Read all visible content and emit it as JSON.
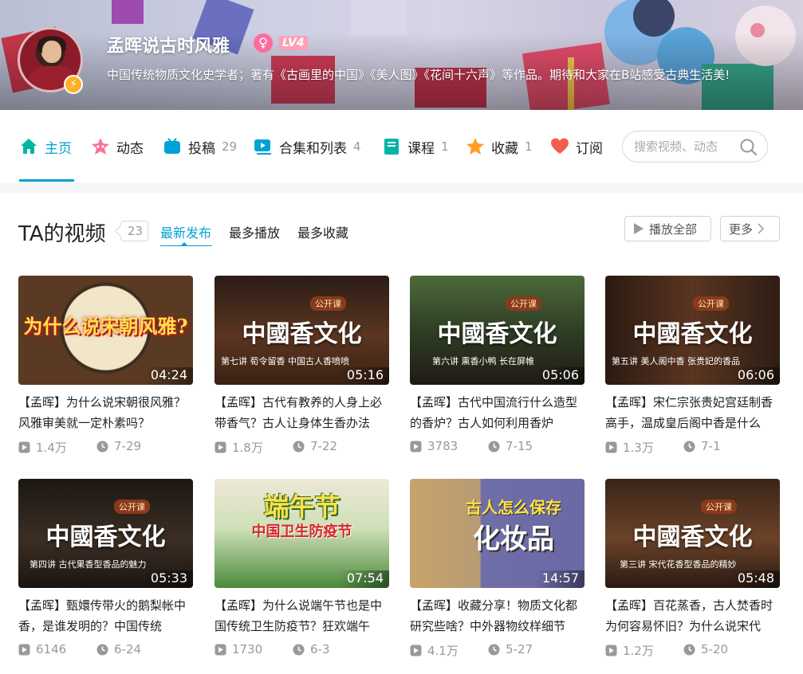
{
  "profile": {
    "name": "孟晖说古时风雅",
    "gender_icon": "♀",
    "level": "LV4",
    "badge_icon": "lightning-icon",
    "sign": "中国传统物质文化史学者；著有《古画里的中国》《美人图》《花间十六声》等作品。期待和大家在B站感受古典生活美!"
  },
  "nav": {
    "items": [
      {
        "label": "主页",
        "count": "",
        "icon": "home-icon",
        "color": "#00b5a5"
      },
      {
        "label": "动态",
        "count": "",
        "icon": "dynamic-icon",
        "color": "#fb7299"
      },
      {
        "label": "投稿",
        "count": "29",
        "icon": "video-icon",
        "color": "#00a1d6"
      },
      {
        "label": "合集和列表",
        "count": "4",
        "icon": "playlist-icon",
        "color": "#00a1d6"
      },
      {
        "label": "课程",
        "count": "1",
        "icon": "course-icon",
        "color": "#00b5a5"
      },
      {
        "label": "收藏",
        "count": "1",
        "icon": "star-icon",
        "color": "#ff9d26"
      },
      {
        "label": "订阅",
        "count": "",
        "icon": "heart-icon",
        "color": "#f25d4e"
      }
    ],
    "search_placeholder": "搜索视频、动态"
  },
  "videos_section": {
    "title": "TA的视频",
    "count": "23",
    "tabs": [
      "最新发布",
      "最多播放",
      "最多收藏"
    ],
    "play_all": "播放全部",
    "more": "更多"
  },
  "videos": [
    {
      "title": "【孟晖】为什么说宋朝很风雅？风雅审美就一定朴素吗？",
      "duration": "04:24",
      "plays": "1.4万",
      "date": "7-29",
      "cover_text": "为什么说宋朝风雅?",
      "cover_tag": "",
      "cover_sub": ""
    },
    {
      "title": "【孟晖】古代有教养的人身上必带香气？古人让身体生香办法",
      "duration": "05:16",
      "plays": "1.8万",
      "date": "7-22",
      "cover_text": "中國香文化",
      "cover_tag": "公开课",
      "cover_sub": "第七讲 荀令留香  中国古人香喷喷"
    },
    {
      "title": "【孟晖】古代中国流行什么造型的香炉？古人如何利用香炉",
      "duration": "05:06",
      "plays": "3783",
      "date": "7-15",
      "cover_text": "中國香文化",
      "cover_tag": "公开课",
      "cover_sub": "第六讲 熏香小鸭  长在屏帷"
    },
    {
      "title": "【孟晖】宋仁宗张贵妃宫廷制香高手，温成皇后阁中香是什么",
      "duration": "06:06",
      "plays": "1.3万",
      "date": "7-1",
      "cover_text": "中國香文化",
      "cover_tag": "公开课",
      "cover_sub": "第五讲 美人阁中香  张贵妃的香品"
    },
    {
      "title": "【孟晖】甄嬛传带火的鹅梨帐中香，是谁发明的？中国传统",
      "duration": "05:33",
      "plays": "6146",
      "date": "6-24",
      "cover_text": "中國香文化",
      "cover_tag": "公开课",
      "cover_sub": "第四讲  古代果香型香品的魅力"
    },
    {
      "title": "【孟晖】为什么说端午节也是中国传统卫生防疫节？狂欢端午",
      "duration": "07:54",
      "plays": "1730",
      "date": "6-3",
      "cover_text": "端午节",
      "cover_tag": "中国卫生防疫节",
      "cover_sub": ""
    },
    {
      "title": "【孟晖】收藏分享！物质文化都研究些啥？中外器物纹样细节",
      "duration": "14:57",
      "plays": "4.1万",
      "date": "5-27",
      "cover_text": "化妆品",
      "cover_tag": "古人怎么保存",
      "cover_sub": ""
    },
    {
      "title": "【孟晖】百花蒸香，古人焚香时为何容易怀旧？为什么说宋代",
      "duration": "05:48",
      "plays": "1.2万",
      "date": "5-20",
      "cover_text": "中國香文化",
      "cover_tag": "公开课",
      "cover_sub": "第三讲  宋代花香型香品的精妙"
    }
  ]
}
